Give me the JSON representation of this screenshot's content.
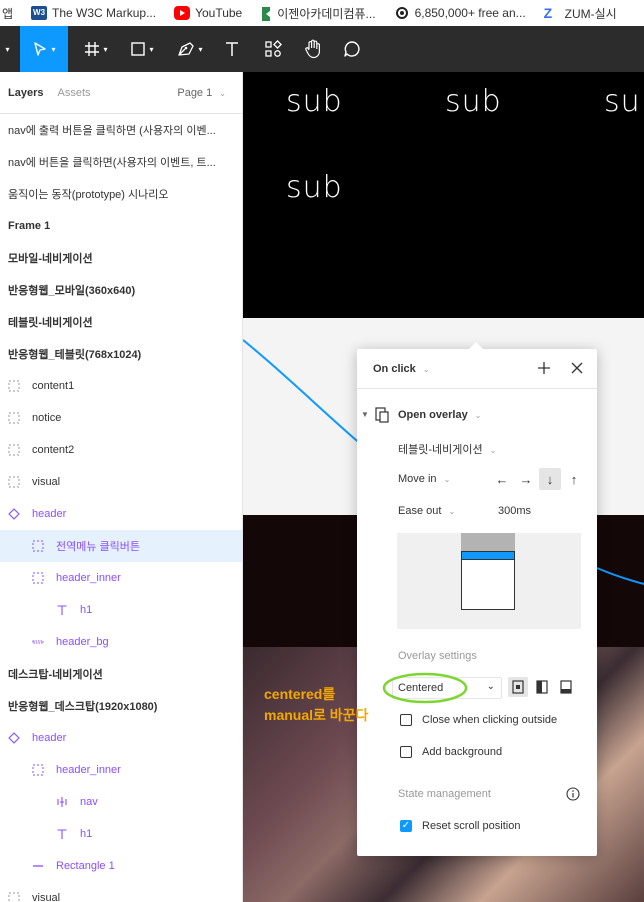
{
  "bookmarks": [
    {
      "label": "앱",
      "icon": "none",
      "color": "#ffffff"
    },
    {
      "label": "The W3C Markup...",
      "icon": "w3c-icon",
      "color": "#1b4f91"
    },
    {
      "label": "YouTube",
      "icon": "youtube-icon",
      "color": "#ff0000"
    },
    {
      "label": "이젠아카데미컴퓨...",
      "icon": "academy-icon",
      "color": "#2a8a4a"
    },
    {
      "label": "6,850,000+ free an...",
      "icon": "free-icons-icon",
      "color": "#222222"
    },
    {
      "label": "ZUM-실시",
      "icon": "zum-icon",
      "color": "#3a6df0"
    }
  ],
  "toolbar": {
    "tools": [
      "menu-icon",
      "move-tool-icon",
      "frame-tool-icon",
      "shape-tool-icon",
      "pen-tool-icon",
      "text-tool-icon",
      "components-icon",
      "hand-tool-icon",
      "comment-icon"
    ],
    "accent": "#0d99ff"
  },
  "layers_panel": {
    "tab_layers": "Layers",
    "tab_assets": "Assets",
    "page": "Page 1",
    "rows": [
      {
        "label": "nav에 출력 버튼을 클릭하면 (사용자의 이벤...",
        "style": "plain",
        "indent": 0,
        "icon": "none"
      },
      {
        "label": "nav에 버튼을 클릭하면(사용자의 이벤트, 트...",
        "style": "plain",
        "indent": 0,
        "icon": "none"
      },
      {
        "label": "움직이는 동작(prototype) 시나리오",
        "style": "plain",
        "indent": 0,
        "icon": "none"
      },
      {
        "label": "Frame 1",
        "style": "bold",
        "indent": 0,
        "icon": "none"
      },
      {
        "label": "모바일-네비게이션",
        "style": "bold",
        "indent": 0,
        "icon": "none"
      },
      {
        "label": "반응형웹_모바일(360x640)",
        "style": "bold",
        "indent": 0,
        "icon": "none"
      },
      {
        "label": "테블릿-네비게이션",
        "style": "bold",
        "indent": 0,
        "icon": "none"
      },
      {
        "label": "반응형웹_테블릿(768x1024)",
        "style": "bold",
        "indent": 0,
        "icon": "none"
      },
      {
        "label": "content1",
        "style": "plain",
        "indent": 0,
        "icon": "frame-icon"
      },
      {
        "label": "notice",
        "style": "plain",
        "indent": 0,
        "icon": "frame-icon"
      },
      {
        "label": "content2",
        "style": "plain",
        "indent": 0,
        "icon": "frame-icon"
      },
      {
        "label": "visual",
        "style": "plain",
        "indent": 0,
        "icon": "frame-icon"
      },
      {
        "label": "header",
        "style": "purple",
        "indent": 0,
        "icon": "component-icon"
      },
      {
        "label": "전역메뉴 클릭버튼",
        "style": "purple-sel",
        "indent": 1,
        "icon": "frame-icon"
      },
      {
        "label": "header_inner",
        "style": "purple",
        "indent": 1,
        "icon": "frame-icon"
      },
      {
        "label": "h1",
        "style": "purple",
        "indent": 2,
        "icon": "text-icon"
      },
      {
        "label": "header_bg",
        "style": "purple",
        "indent": 1,
        "icon": "rectangle-icon"
      },
      {
        "label": "데스크탑-네비게이션",
        "style": "bold",
        "indent": 0,
        "icon": "none"
      },
      {
        "label": "반응형웹_데스크탑(1920x1080)",
        "style": "bold",
        "indent": 0,
        "icon": "none"
      },
      {
        "label": "header",
        "style": "purple",
        "indent": 0,
        "icon": "component-icon"
      },
      {
        "label": "header_inner",
        "style": "purple",
        "indent": 1,
        "icon": "frame-icon"
      },
      {
        "label": "nav",
        "style": "purple",
        "indent": 2,
        "icon": "auto-layout-icon"
      },
      {
        "label": "h1",
        "style": "purple",
        "indent": 2,
        "icon": "text-icon"
      },
      {
        "label": "Rectangle 1",
        "style": "purple",
        "indent": 1,
        "icon": "line-icon"
      },
      {
        "label": "visual",
        "style": "plain",
        "indent": 0,
        "icon": "frame-icon"
      }
    ]
  },
  "canvas": {
    "sub_texts": [
      "sub",
      "sub",
      "su",
      "sub"
    ],
    "wire_color": "#0d99ff"
  },
  "interaction": {
    "trigger": "On click",
    "action": "Open overlay",
    "destination": "테블릿-네비게이션",
    "animation": "Move in",
    "easing": "Ease out",
    "duration": "300ms",
    "directions": [
      "←",
      "→",
      "↓",
      "↑"
    ],
    "selected_direction": "↓",
    "overlay_settings_title": "Overlay settings",
    "position": "Centered",
    "close_outside_label": "Close when clicking outside",
    "close_outside_checked": false,
    "add_background_label": "Add background",
    "add_background_checked": false,
    "state_title": "State management",
    "reset_scroll_label": "Reset scroll position",
    "reset_scroll_checked": true
  },
  "annotation": {
    "line1": "centered를",
    "line2": "manual로 바꾼다",
    "color": "#f5a800",
    "circle_color": "#7bd62f"
  }
}
